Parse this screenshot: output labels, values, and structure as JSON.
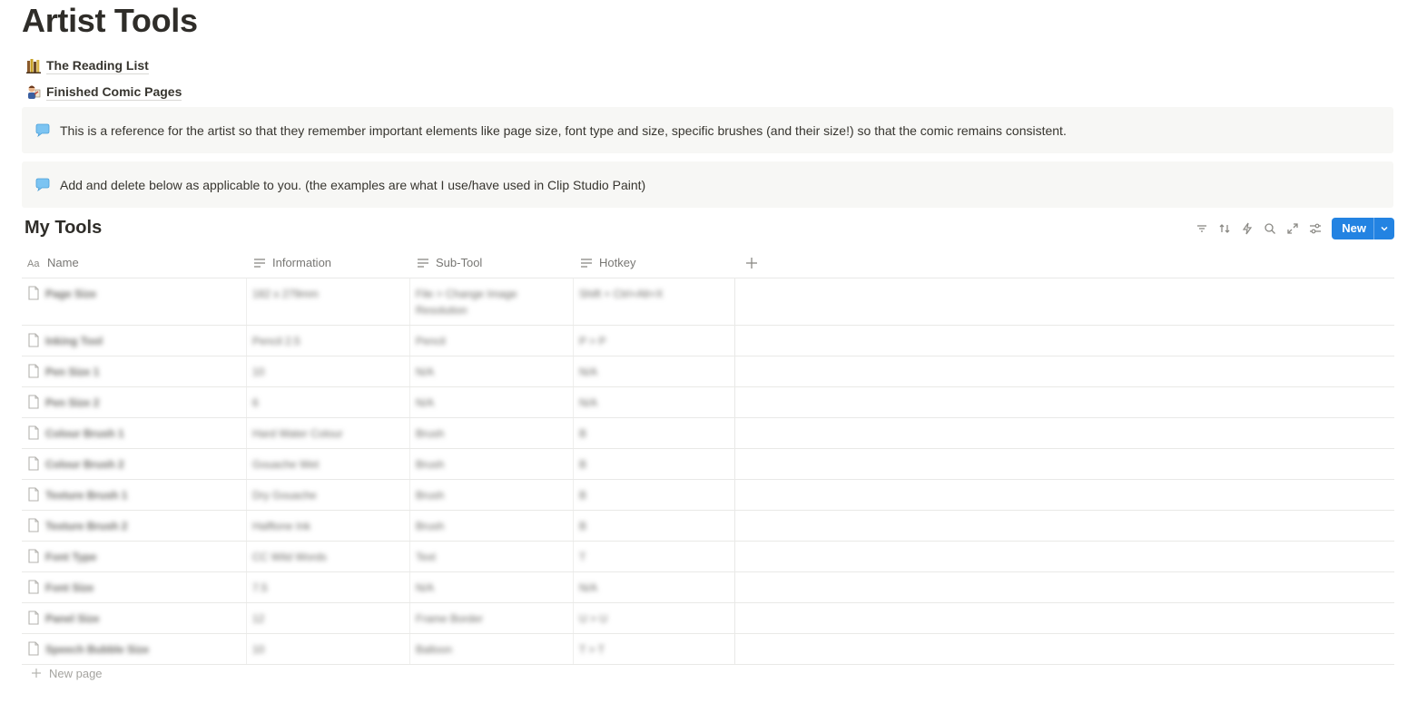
{
  "page": {
    "title": "Artist Tools"
  },
  "links": [
    {
      "label": "The Reading List",
      "icon": "books-emoji-icon"
    },
    {
      "label": "Finished Comic Pages",
      "icon": "artist-emoji-icon"
    }
  ],
  "callouts": [
    {
      "text": "This is a reference for the artist so that they remember important elements like page size, font type and size, specific brushes (and their size!) so that the comic remains consistent.",
      "icon": "speech-bubble-icon"
    },
    {
      "text": "Add and delete below as applicable to you. (the examples are what I use/have used in Clip Studio Paint)",
      "icon": "speech-bubble-icon"
    }
  ],
  "database": {
    "title": "My Tools",
    "new_label": "New",
    "new_page_label": "New page",
    "columns": [
      {
        "label": "Name",
        "icon": "title-property-icon"
      },
      {
        "label": "Information",
        "icon": "text-property-icon"
      },
      {
        "label": "Sub-Tool",
        "icon": "text-property-icon"
      },
      {
        "label": "Hotkey",
        "icon": "text-property-icon"
      }
    ],
    "rows": [
      {
        "name": "Page Size",
        "info": "182 x 279mm",
        "sub": "File > Change Image Resolution",
        "hot": "Shift + Ctrl+Alt+X"
      },
      {
        "name": "Inking Tool",
        "info": "Pencil 2.5",
        "sub": "Pencil",
        "hot": "P > P"
      },
      {
        "name": "Pen Size 1",
        "info": "10",
        "sub": "N/A",
        "hot": "N/A"
      },
      {
        "name": "Pen Size 2",
        "info": "6",
        "sub": "N/A",
        "hot": "N/A"
      },
      {
        "name": "Colour Brush 1",
        "info": "Hard Water Colour",
        "sub": "Brush",
        "hot": "B"
      },
      {
        "name": "Colour Brush 2",
        "info": "Gouache Wet",
        "sub": "Brush",
        "hot": "B"
      },
      {
        "name": "Texture Brush 1",
        "info": "Dry Gouache",
        "sub": "Brush",
        "hot": "B"
      },
      {
        "name": "Texture Brush 2",
        "info": "Halftone Ink",
        "sub": "Brush",
        "hot": "B"
      },
      {
        "name": "Font Type",
        "info": "CC Wild Words",
        "sub": "Text",
        "hot": "T"
      },
      {
        "name": "Font Size",
        "info": "7.5",
        "sub": "N/A",
        "hot": "N/A"
      },
      {
        "name": "Panel Size",
        "info": "12",
        "sub": "Frame Border",
        "hot": "U > U"
      },
      {
        "name": "Speech Bubble Size",
        "info": "10",
        "sub": "Balloon",
        "hot": "T > T"
      }
    ]
  }
}
